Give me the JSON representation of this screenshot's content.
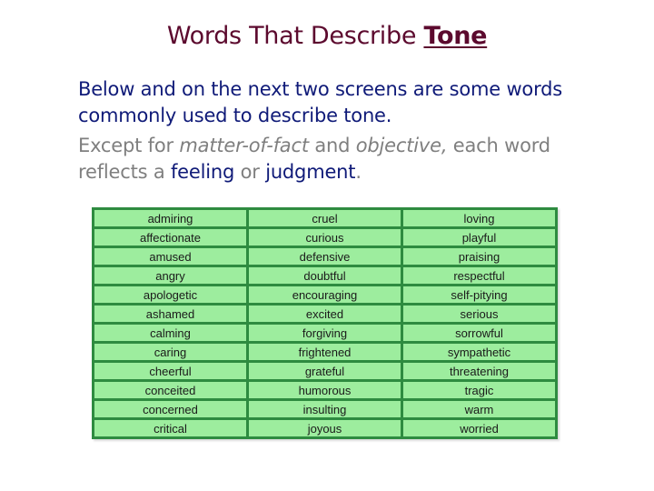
{
  "title": {
    "prefix": "Words That Describe ",
    "emphasis": "Tone"
  },
  "paragraph1": "Below and on the next two screens are some words commonly used to describe tone.",
  "paragraph2": {
    "part1": "Except for ",
    "italic1": "matter-of-fact",
    "part2": " and ",
    "italic2": "objective,",
    "part3": " each word reflects a ",
    "highlight1": "feeling",
    "part4": " or ",
    "highlight2": "judgment",
    "part5": "."
  },
  "colors": {
    "title": "#5c0a2e",
    "body_text": "#0f1a78",
    "muted_text": "#7f7f7f",
    "table_fill": "#9ded9e",
    "table_border": "#2e8b40"
  },
  "table": {
    "rows": [
      [
        "admiring",
        "cruel",
        "loving"
      ],
      [
        "affectionate",
        "curious",
        "playful"
      ],
      [
        "amused",
        "defensive",
        "praising"
      ],
      [
        "angry",
        "doubtful",
        "respectful"
      ],
      [
        "apologetic",
        "encouraging",
        "self-pitying"
      ],
      [
        "ashamed",
        "excited",
        "serious"
      ],
      [
        "calming",
        "forgiving",
        "sorrowful"
      ],
      [
        "caring",
        "frightened",
        "sympathetic"
      ],
      [
        "cheerful",
        "grateful",
        "threatening"
      ],
      [
        "conceited",
        "humorous",
        "tragic"
      ],
      [
        "concerned",
        "insulting",
        "warm"
      ],
      [
        "critical",
        "joyous",
        "worried"
      ]
    ]
  }
}
